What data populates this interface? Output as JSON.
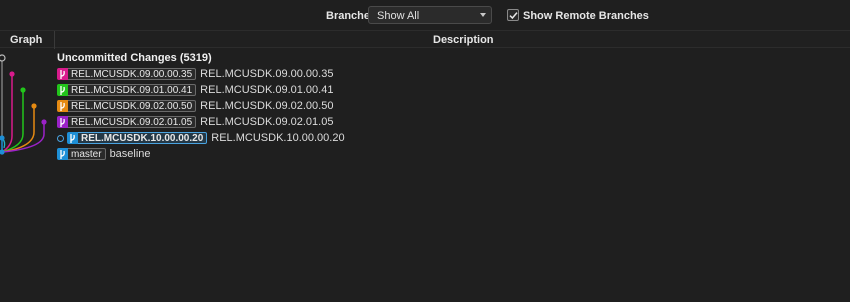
{
  "toolbar": {
    "branches_label": "Branches:",
    "branches_value": "Show All",
    "show_remote_label": "Show Remote Branches",
    "show_remote_checked": true
  },
  "columns": {
    "graph": "Graph",
    "description": "Description"
  },
  "uncommitted": "Uncommitted Changes (5319)",
  "commits": [
    {
      "ref": "REL.MCUSDK.09.00.00.35",
      "message": "REL.MCUSDK.09.00.00.35",
      "color": "#d81b8c",
      "head": false
    },
    {
      "ref": "REL.MCUSDK.09.01.00.41",
      "message": "REL.MCUSDK.09.01.00.41",
      "color": "#22c51b",
      "head": false
    },
    {
      "ref": "REL.MCUSDK.09.02.00.50",
      "message": "REL.MCUSDK.09.02.00.50",
      "color": "#e58a12",
      "head": false
    },
    {
      "ref": "REL.MCUSDK.09.02.01.05",
      "message": "REL.MCUSDK.09.02.01.05",
      "color": "#9b22c8",
      "head": false
    },
    {
      "ref": "REL.MCUSDK.10.00.00.20",
      "message": "REL.MCUSDK.10.00.00.20",
      "color": "#1e8fd6",
      "head": true
    },
    {
      "ref": "master",
      "message": "baseline",
      "color": "#1e8fd6",
      "head": false
    }
  ],
  "icons": {
    "branch": "branch-icon",
    "tag": "tag-icon",
    "check": "check-icon",
    "chevron": "chevron-down-icon"
  }
}
